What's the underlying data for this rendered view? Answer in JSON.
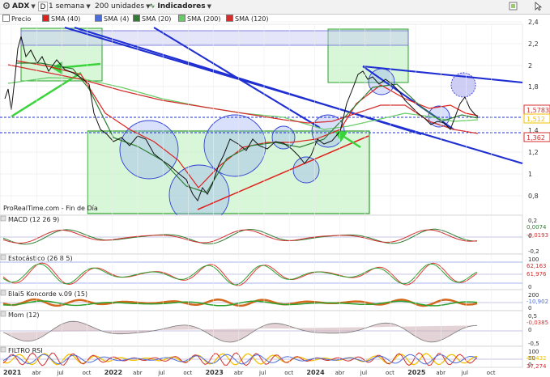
{
  "toolbar": {
    "ticker": "ADX",
    "chart_type_letter": "D",
    "period": "1 semana",
    "units": "200 unidades",
    "indicators_label": "Indicadores"
  },
  "legend": [
    {
      "label": "Precio",
      "color": "#ffffff"
    },
    {
      "label": "SMA (40)",
      "color": "#e0201b"
    },
    {
      "label": "SMA (4)",
      "color": "#4f6dd9"
    },
    {
      "label": "SMA (20)",
      "color": "#2e7d32"
    },
    {
      "label": "SMA (200)",
      "color": "#66cc66"
    },
    {
      "label": "SMA (120)",
      "color": "#d32f2f"
    }
  ],
  "source_label": "ProRealTime.com - Fin de Día",
  "price_axis": {
    "ticks": [
      "2,4",
      "2,2",
      "2",
      "1,8",
      "1,6",
      "1,4",
      "1,2",
      "1",
      "0,8"
    ],
    "tags": [
      {
        "text": "1,5783",
        "color": "#d32f2f"
      },
      {
        "text": "1,512",
        "color": "#f2c200"
      },
      {
        "text": "1,362",
        "color": "#d32f2f"
      }
    ]
  },
  "time_axis": [
    "2021",
    "abr",
    "jul",
    "oct",
    "2022",
    "abr",
    "jul",
    "oct",
    "2023",
    "abr",
    "jul",
    "oct",
    "2024",
    "abr",
    "jul",
    "oct",
    "2025",
    "abr",
    "jul",
    "oct"
  ],
  "panels": [
    {
      "id": "macd",
      "title": "MACD (12 26 9)",
      "scale": [
        "0,2",
        "0",
        "-0,2"
      ],
      "tags": [
        {
          "text": "0,0074",
          "color": "#2e7d32"
        },
        {
          "text": "-0,0193",
          "color": "#d32f2f"
        }
      ]
    },
    {
      "id": "stoch",
      "title": "Estocástico (26 8 5)",
      "scale": [
        "100",
        "0"
      ],
      "tags": [
        {
          "text": "62,163",
          "color": "#d32f2f"
        },
        {
          "text": "61,976",
          "color": "#d32f2f"
        }
      ]
    },
    {
      "id": "koncorde",
      "title": "Blai5 Koncorde v.09 (15)",
      "scale": [
        "200",
        "0"
      ],
      "tags": [
        {
          "text": "-10,902",
          "color": "#4f6dd9"
        }
      ]
    },
    {
      "id": "mom",
      "title": "Mom (12)",
      "scale": [
        "0,5",
        "0",
        "-0,5"
      ],
      "tags": [
        {
          "text": "-0,0385",
          "color": "#d32f2f"
        }
      ]
    },
    {
      "id": "rsi",
      "title": "FILTRO RSI",
      "scale": [
        "100",
        "50",
        "0"
      ],
      "tags": [
        {
          "text": "46,432",
          "color": "#f2c200"
        },
        {
          "text": "37,274",
          "color": "#d32f2f"
        }
      ]
    }
  ],
  "colors": {
    "price_candle": "#000000",
    "sma40": "#e0201b",
    "sma20": "#2e7d32",
    "sma200": "#66cc66",
    "trend_blue": "#1f2fd1",
    "box_green": "#9be39b",
    "arrow_green": "#3bd33b"
  }
}
